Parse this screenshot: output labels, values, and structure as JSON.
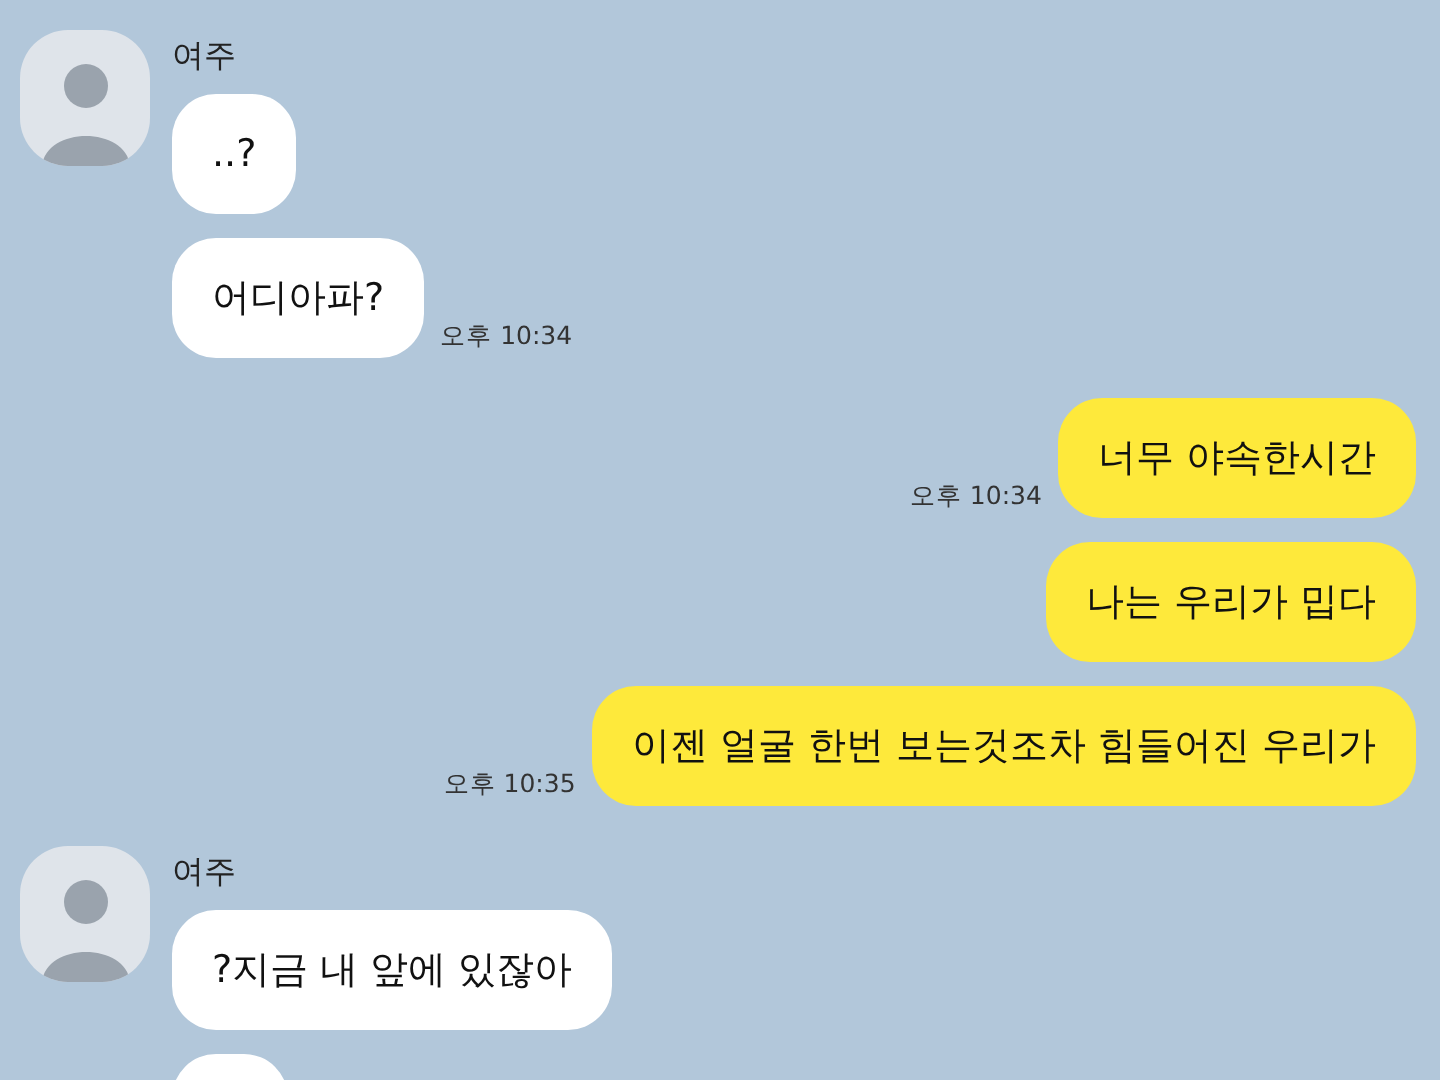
{
  "groups": [
    {
      "kind": "received",
      "sender": "여주",
      "messages": [
        {
          "kind": "text",
          "text": "..?"
        },
        {
          "kind": "text",
          "text": "어디아파?",
          "time": "오후 10:34"
        }
      ]
    },
    {
      "kind": "sent",
      "messages": [
        {
          "kind": "text",
          "text": "너무 야속한시간",
          "time": "오후 10:34"
        },
        {
          "kind": "text",
          "text": "나는 우리가 밉다"
        },
        {
          "kind": "text",
          "text": "이젠 얼굴 한번 보는것조차 힘들어진 우리가",
          "time": "오후 10:35"
        }
      ]
    },
    {
      "kind": "received",
      "sender": "여주",
      "messages": [
        {
          "kind": "text",
          "text": "?지금 내 앞에 있잖아"
        },
        {
          "kind": "clipped"
        }
      ]
    }
  ]
}
